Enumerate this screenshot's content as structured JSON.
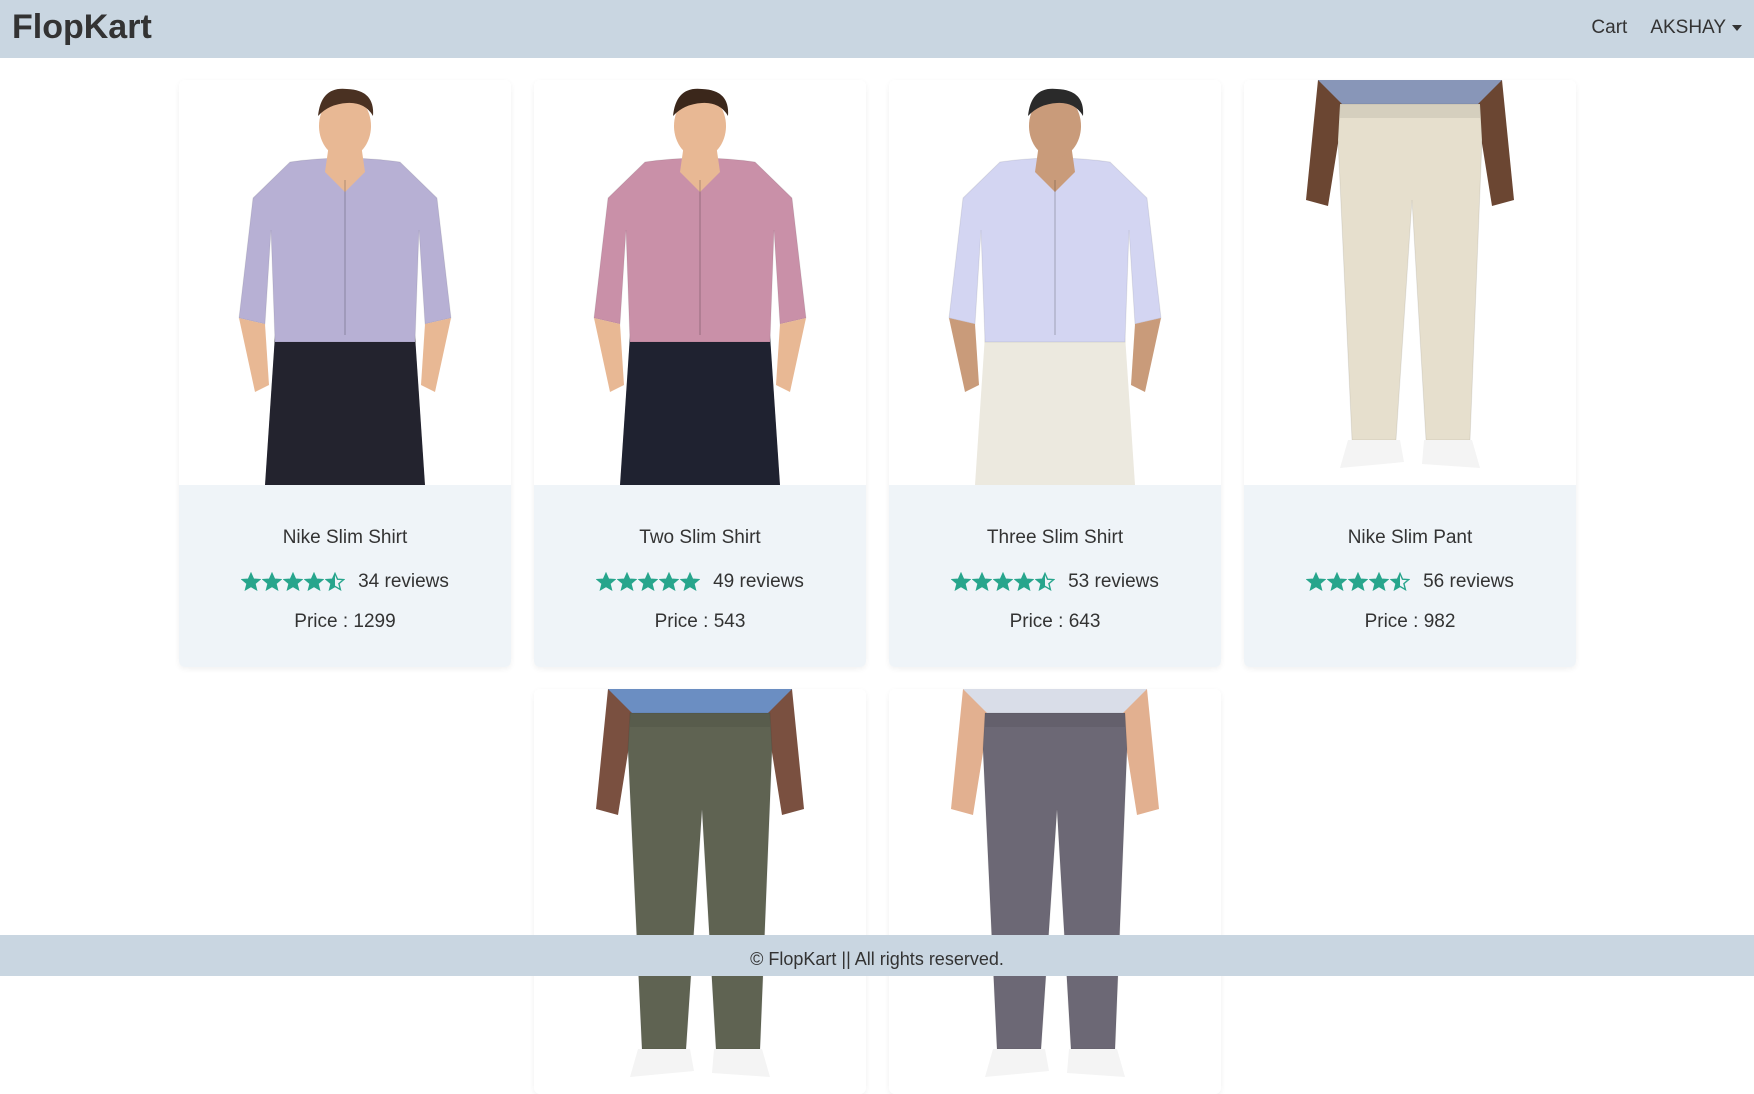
{
  "navbar": {
    "brand": "FlopKart",
    "cart_label": "Cart",
    "user_label": "AKSHAY"
  },
  "products": [
    {
      "name": "Nike Slim Shirt",
      "rating": 4.5,
      "reviews_label": "34 reviews",
      "price_label": "Price : 1299",
      "type": "shirt",
      "shirt_color": "#b7b0d4",
      "pants_color": "#23232e",
      "skin": "#e8b894",
      "hair": "#4a3122"
    },
    {
      "name": "Two Slim Shirt",
      "rating": 5,
      "reviews_label": "49 reviews",
      "price_label": "Price : 543",
      "type": "shirt",
      "shirt_color": "#c990a8",
      "pants_color": "#1f2230",
      "skin": "#e8b894",
      "hair": "#3b271b"
    },
    {
      "name": "Three Slim Shirt",
      "rating": 4.5,
      "reviews_label": "53 reviews",
      "price_label": "Price : 643",
      "type": "shirt",
      "shirt_color": "#d3d5f2",
      "pants_color": "#ece9df",
      "skin": "#c99b7a",
      "hair": "#2a2a2a"
    },
    {
      "name": "Nike Slim Pant",
      "rating": 4.5,
      "reviews_label": "56 reviews",
      "price_label": "Price : 982",
      "type": "pant",
      "shirt_color": "#8896b8",
      "pants_color": "#e6dfcd",
      "skin": "#6b4632"
    },
    {
      "name": "",
      "type": "pant",
      "shirt_color": "#6b8ec2",
      "pants_color": "#5f6352",
      "skin": "#7a5040"
    },
    {
      "name": "",
      "type": "pant",
      "shirt_color": "#d9dde8",
      "pants_color": "#6c6875",
      "skin": "#e2b090"
    }
  ],
  "colors": {
    "star": "#27a58c",
    "navbar_bg": "#c9d6e1",
    "card_info_bg": "#eff4f8"
  },
  "footer": {
    "text": "© FlopKart || All rights reserved."
  }
}
